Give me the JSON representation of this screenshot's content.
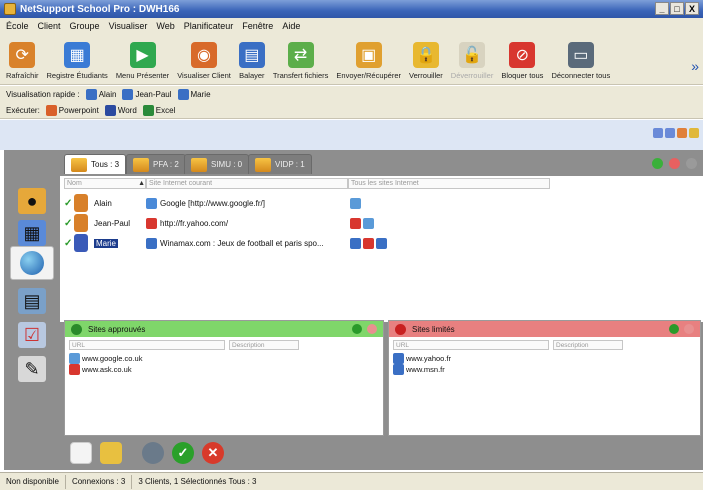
{
  "window": {
    "title": "NetSupport School Pro : DWH166",
    "controls": [
      "_",
      "□",
      "X"
    ]
  },
  "menu": [
    "École",
    "Client",
    "Groupe",
    "Visualiser",
    "Web",
    "Planificateur",
    "Fenêtre",
    "Aide"
  ],
  "toolbar": [
    {
      "label": "Rafraîchir",
      "icon": "refresh-icon",
      "color": "#d9822b",
      "glyph": "⟳"
    },
    {
      "label": "Registre Étudiants",
      "icon": "register-icon",
      "color": "#3a7bd5",
      "glyph": "▦"
    },
    {
      "label": "Menu Présenter",
      "icon": "present-icon",
      "color": "#2fa84f",
      "glyph": "▶"
    },
    {
      "label": "Visualiser Client",
      "icon": "view-client-icon",
      "color": "#d86a2a",
      "glyph": "◉"
    },
    {
      "label": "Balayer",
      "icon": "scan-icon",
      "color": "#3a6fc4",
      "glyph": "▤"
    },
    {
      "label": "Transfert fichiers",
      "icon": "file-transfer-icon",
      "color": "#5cae4a",
      "glyph": "⇄"
    },
    {
      "label": "Envoyer/Récupérer",
      "icon": "send-receive-icon",
      "color": "#e0a030",
      "glyph": "▣"
    },
    {
      "label": "Verrouiller",
      "icon": "lock-icon",
      "color": "#e8b830",
      "glyph": "🔒"
    },
    {
      "label": "Déverrouiller",
      "icon": "unlock-icon",
      "color": "#d8d3c0",
      "glyph": "🔓",
      "disabled": true
    },
    {
      "label": "Bloquer tous",
      "icon": "block-all-icon",
      "color": "#d8372f",
      "glyph": "⊘"
    },
    {
      "label": "Déconnecter tous",
      "icon": "disconnect-icon",
      "color": "#5a6a7a",
      "glyph": "▭"
    }
  ],
  "quick_view": {
    "label": "Visualisation rapide :",
    "clients": [
      "Alain",
      "Jean-Paul",
      "Marie"
    ]
  },
  "run": {
    "label": "Exécuter:",
    "apps": [
      {
        "name": "Powerpoint",
        "color": "#d9602a"
      },
      {
        "name": "Word",
        "color": "#2b4aa0"
      },
      {
        "name": "Excel",
        "color": "#2a8a3a"
      }
    ]
  },
  "tabs": [
    {
      "label": "Tous : 3",
      "active": true
    },
    {
      "label": "PFA : 2",
      "active": false
    },
    {
      "label": "SIMU : 0",
      "active": false
    },
    {
      "label": "VIDP : 1",
      "active": false
    }
  ],
  "columns": {
    "name": "Nom",
    "current": "Site Internet courant",
    "all": "Tous les sites Internet"
  },
  "clients": [
    {
      "name": "Alain",
      "url": "Google [http://www.google.fr/]",
      "url_icon": "#4a8ad8",
      "selected": false,
      "person_color": "#d8802a",
      "sites": [
        "#5a9ad8"
      ]
    },
    {
      "name": "Jean-Paul",
      "url": "http://fr.yahoo.com/",
      "url_icon": "#d8372f",
      "selected": false,
      "person_color": "#d8802a",
      "sites": [
        "#d8372f",
        "#5a9ad8"
      ]
    },
    {
      "name": "Marie",
      "url": "Winamax.com : Jeux de football et paris spo...",
      "url_icon": "#3a6fc4",
      "selected": true,
      "person_color": "#3a5ab8",
      "sites": [
        "#3a6fc4",
        "#d8372f",
        "#3a6fc4"
      ]
    }
  ],
  "approved": {
    "title": "Sites approuvés",
    "header_color": "#7fd66a",
    "col_url": "URL",
    "col_desc": "Description",
    "items": [
      {
        "text": "www.google.co.uk",
        "icon": "#5a9ad8"
      },
      {
        "text": "www.ask.co.uk",
        "icon": "#d8372f"
      }
    ]
  },
  "restricted": {
    "title": "Sites limités",
    "header_color": "#e88080",
    "col_url": "URL",
    "col_desc": "Description",
    "items": [
      {
        "text": "www.yahoo.fr",
        "icon": "#3a6fc4"
      },
      {
        "text": "www.msn.fr",
        "icon": "#3a6fc4"
      }
    ]
  },
  "status": [
    "Non disponible",
    "Connexions : 3",
    "3 Clients, 1 Sélectionnés  Tous : 3"
  ]
}
